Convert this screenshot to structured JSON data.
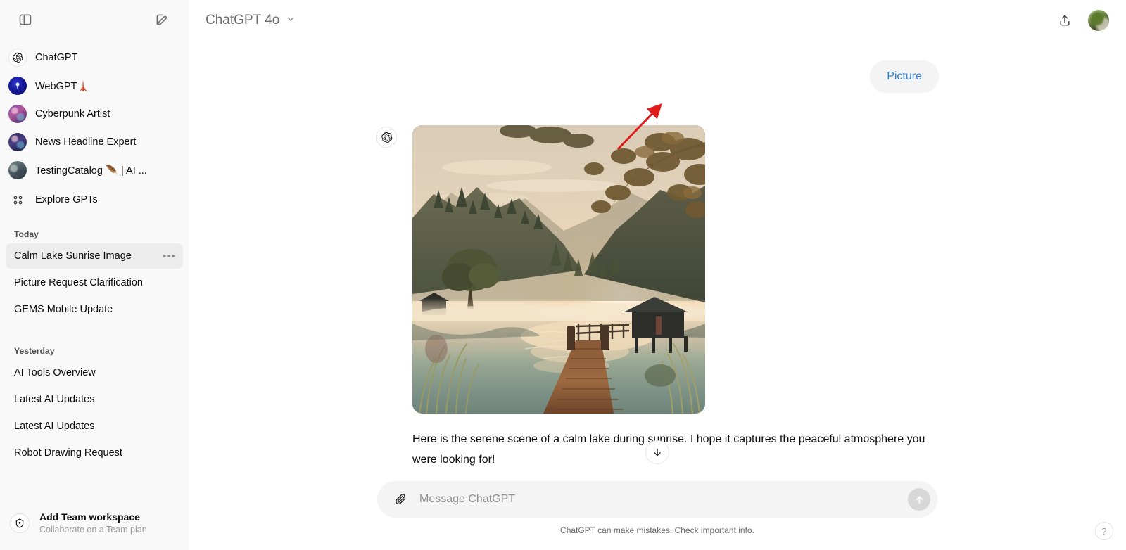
{
  "sidebar": {
    "toggle_icon": "sidebar-panel-icon",
    "new_chat_icon": "compose-icon",
    "gpts": [
      {
        "label": "ChatGPT",
        "icon": "openai-logo-icon",
        "avatar": "chatgpt"
      },
      {
        "label": "WebGPT🗼",
        "icon": "webgpt-avatar",
        "avatar": "webgpt"
      },
      {
        "label": "Cyberpunk Artist",
        "icon": "cyberpunk-avatar",
        "avatar": "cyber"
      },
      {
        "label": "News Headline Expert",
        "icon": "news-avatar",
        "avatar": "news"
      },
      {
        "label": "TestingCatalog 🪶 | AI ...",
        "icon": "testingcatalog-avatar",
        "avatar": "testcat"
      }
    ],
    "explore": {
      "label": "Explore GPTs",
      "icon": "grid-apps-icon"
    },
    "sections": [
      {
        "title": "Today",
        "chats": [
          {
            "name": "Calm Lake Sunrise Image",
            "active": true,
            "menu": "•••"
          },
          {
            "name": "Picture Request Clarification",
            "active": false
          },
          {
            "name": "GEMS Mobile Update",
            "active": false
          }
        ]
      },
      {
        "title": "Yesterday",
        "chats": [
          {
            "name": "AI Tools Overview",
            "active": false
          },
          {
            "name": "Latest AI Updates",
            "active": false
          },
          {
            "name": "Latest AI Updates",
            "active": false
          },
          {
            "name": "Robot Drawing Request",
            "active": false
          }
        ]
      }
    ],
    "team": {
      "title": "Add Team workspace",
      "subtitle": "Collaborate on a Team plan",
      "icon": "team-badge-icon"
    }
  },
  "topbar": {
    "model": "ChatGPT 4o",
    "chevron_icon": "chevron-down-icon",
    "share_icon": "share-upload-icon",
    "avatar_icon": "user-avatar"
  },
  "conversation": {
    "user_message": "Picture",
    "assistant_avatar": "openai-logo-icon",
    "assistant_text": "Here is the serene scene of a calm lake during sunrise. I hope it captures the peaceful atmosphere you were looking for!",
    "image_alt": "Calm lake at sunrise with wooden dock, misty forest hills and boathouse",
    "actions": [
      {
        "name": "thumbs-up-icon"
      },
      {
        "name": "speaker-icon"
      },
      {
        "name": "share-icon"
      },
      {
        "name": "copy-icon"
      },
      {
        "name": "regenerate-icon"
      }
    ],
    "scroll_down_icon": "arrow-down-icon"
  },
  "annotation": {
    "arrow": "red-arrow-pointing-to-user-message",
    "color": "#e01b1b"
  },
  "composer": {
    "attach_icon": "paperclip-icon",
    "placeholder": "Message ChatGPT",
    "value": "",
    "send_icon": "arrow-up-icon"
  },
  "footer": {
    "disclaimer": "ChatGPT can make mistakes. Check important info.",
    "help": "?"
  },
  "colors": {
    "sidebar_bg": "#f9f9f9",
    "main_bg": "#ffffff",
    "bubble_bg": "#f4f4f4",
    "user_text_blue": "#3080d0",
    "active_chat_bg": "#ececec",
    "annotation_red": "#e01b1b"
  }
}
